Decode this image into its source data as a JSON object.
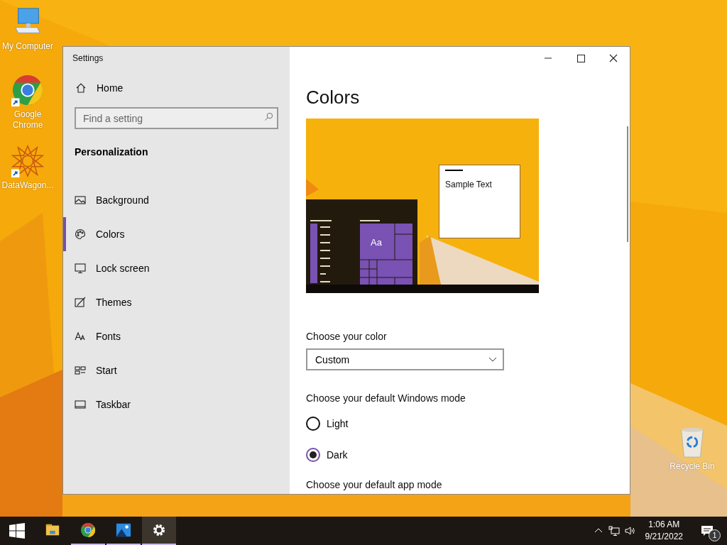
{
  "desktop_icons": [
    {
      "label": "My Computer",
      "kind": "computer",
      "shortcut": false
    },
    {
      "label": "Google Chrome",
      "kind": "chrome",
      "shortcut": true
    },
    {
      "label": "DataWagon...",
      "kind": "star",
      "shortcut": true
    },
    {
      "label": "Recycle Bin",
      "kind": "recycle",
      "shortcut": false
    }
  ],
  "window": {
    "title": "Settings",
    "sidebar": {
      "home": "Home",
      "search": {
        "placeholder": "Find a setting"
      },
      "section": "Personalization",
      "items": [
        {
          "label": "Background",
          "selected": false
        },
        {
          "label": "Colors",
          "selected": true
        },
        {
          "label": "Lock screen",
          "selected": false
        },
        {
          "label": "Themes",
          "selected": false
        },
        {
          "label": "Fonts",
          "selected": false
        },
        {
          "label": "Start",
          "selected": false
        },
        {
          "label": "Taskbar",
          "selected": false
        }
      ]
    },
    "content": {
      "heading": "Colors",
      "preview": {
        "sample_text": "Sample Text",
        "tile_text": "Aa"
      },
      "color_label": "Choose your color",
      "color_dropdown": {
        "value": "Custom"
      },
      "mode_label": "Choose your default Windows mode",
      "modes": [
        {
          "label": "Light",
          "selected": false
        },
        {
          "label": "Dark",
          "selected": true
        }
      ],
      "app_mode_label": "Choose your default app mode"
    }
  },
  "taskbar": {
    "apps": [
      {
        "kind": "explorer",
        "running": false,
        "active": false
      },
      {
        "kind": "chrome",
        "running": true,
        "active": false
      },
      {
        "kind": "photos",
        "running": true,
        "active": false
      },
      {
        "kind": "settings",
        "running": true,
        "active": true
      }
    ],
    "time": "1:06 AM",
    "date": "9/21/2022",
    "notification_count": "1"
  }
}
